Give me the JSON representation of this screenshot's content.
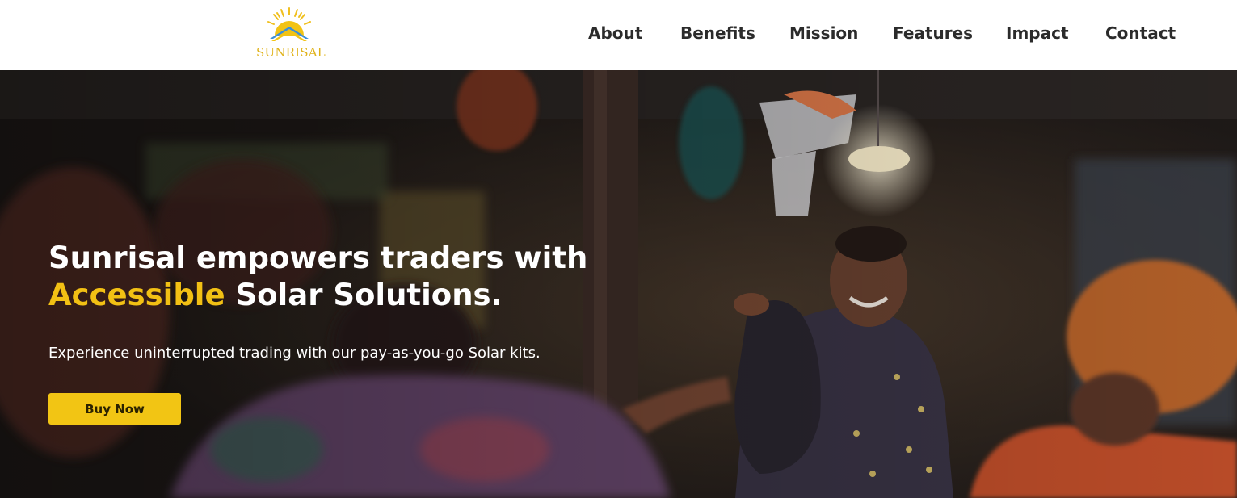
{
  "brand": {
    "name": "SUNRISAL",
    "logo_color": "#e0b31b",
    "logo_sky_color": "#3a8fd9"
  },
  "nav": {
    "items": [
      {
        "label": "About"
      },
      {
        "label": "Benefits"
      },
      {
        "label": "Mission"
      },
      {
        "label": "Features"
      },
      {
        "label": "Impact"
      },
      {
        "label": "Contact"
      }
    ]
  },
  "hero": {
    "title_line1": "Sunrisal empowers traders with",
    "title_accent": "Accessible",
    "title_rest": " Solar Solutions.",
    "subtitle": "Experience uninterrupted trading with our pay-as-you-go Solar kits.",
    "cta_label": "Buy Now",
    "accent_color": "#f2c014",
    "button_color": "#f2c514"
  }
}
